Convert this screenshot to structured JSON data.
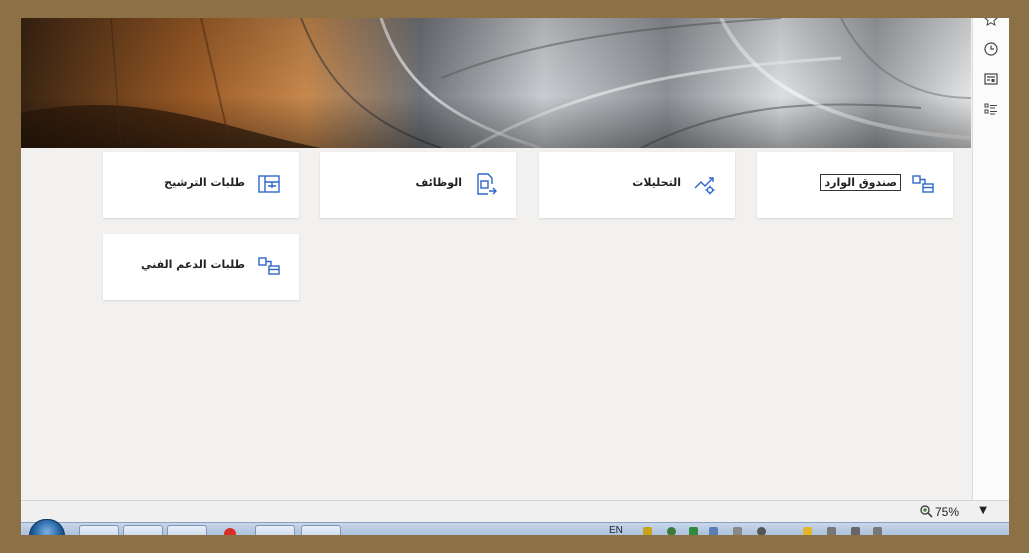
{
  "tiles": [
    {
      "label": "صندوق الوارد",
      "icon": "inbox-icon"
    },
    {
      "label": "التحليلات",
      "icon": "analytics-icon"
    },
    {
      "label": "الوظائف",
      "icon": "jobs-icon"
    },
    {
      "label": "طلبات الترشيح",
      "icon": "nominations-icon"
    },
    {
      "label": "طلبات الدعم الفني",
      "icon": "support-requests-icon"
    }
  ],
  "rightbar": {
    "icons": [
      "star-icon",
      "clock-icon",
      "news-icon",
      "list-icon"
    ]
  },
  "statusbar": {
    "zoom": "75%"
  },
  "taskbar": {
    "language": "EN"
  }
}
